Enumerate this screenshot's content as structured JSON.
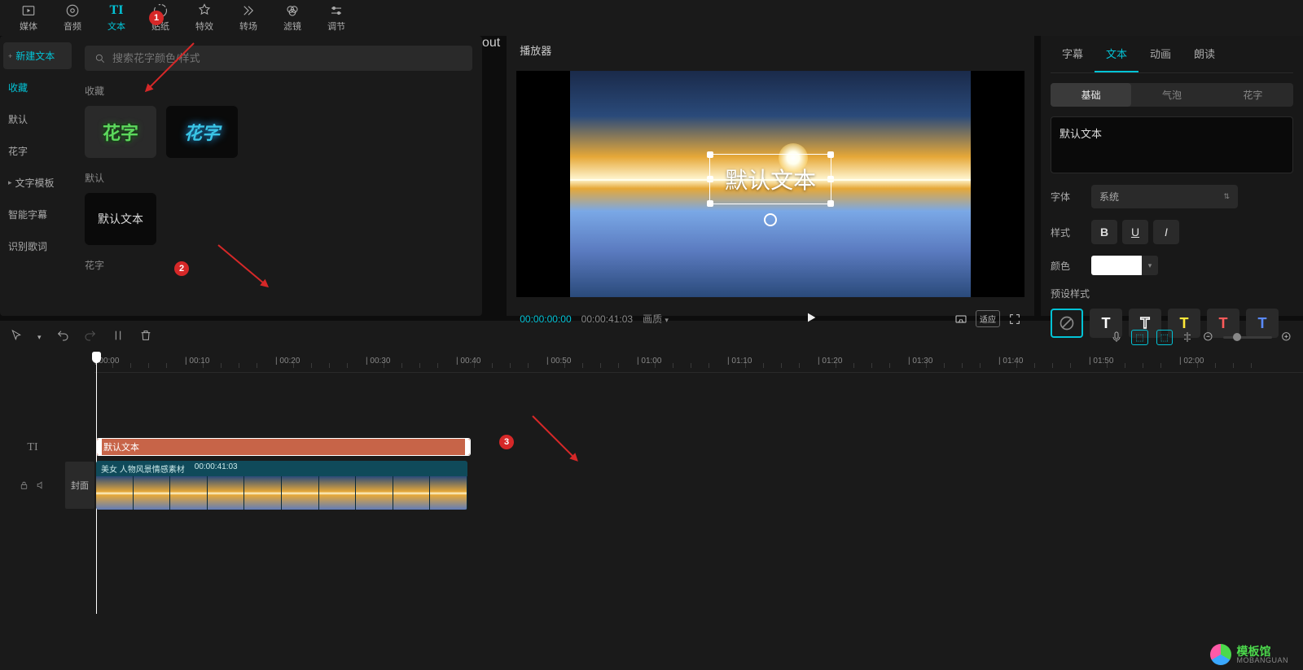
{
  "toolbar": [
    {
      "label": "媒体",
      "icon": "media"
    },
    {
      "label": "音频",
      "icon": "audio"
    },
    {
      "label": "文本",
      "icon": "text",
      "active": true
    },
    {
      "label": "贴纸",
      "icon": "sticker"
    },
    {
      "label": "特效",
      "icon": "effect"
    },
    {
      "label": "转场",
      "icon": "transition"
    },
    {
      "label": "滤镜",
      "icon": "filter"
    },
    {
      "label": "调节",
      "icon": "adjust"
    }
  ],
  "sidebar": [
    {
      "label": "新建文本",
      "active": true,
      "prefix": "+"
    },
    {
      "label": "收藏"
    },
    {
      "label": "默认"
    },
    {
      "label": "花字"
    },
    {
      "label": "文字模板",
      "expandable": true
    },
    {
      "label": "智能字幕"
    },
    {
      "label": "识别歌词"
    }
  ],
  "search": {
    "placeholder": "搜索花字颜色/样式"
  },
  "sections": {
    "favorites": "收藏",
    "default": "默认",
    "huazi": "花字"
  },
  "presets": {
    "huazi1": "花字",
    "huazi2": "花字",
    "default_text": "默认文本"
  },
  "player": {
    "title": "播放器",
    "current": "00:00:00:00",
    "total": "00:00:41:03",
    "quality": "画质",
    "ratio_btn": "适应",
    "overlay_text": "默认文本"
  },
  "right_panel": {
    "tabs": [
      {
        "label": "字幕"
      },
      {
        "label": "文本",
        "active": true
      },
      {
        "label": "动画"
      },
      {
        "label": "朗读"
      }
    ],
    "sub_tabs": [
      {
        "label": "基础",
        "active": true
      },
      {
        "label": "气泡"
      },
      {
        "label": "花字"
      }
    ],
    "text_content": "默认文本",
    "font_label": "字体",
    "font_value": "系统",
    "style_label": "样式",
    "color_label": "颜色",
    "preset_label": "预设样式"
  },
  "timeline": {
    "ticks": [
      "00:00",
      "00:10",
      "00:20",
      "00:30",
      "00:40",
      "00:50",
      "01:00",
      "01:10",
      "01:20",
      "01:30",
      "01:40",
      "01:50",
      "02:00"
    ],
    "text_clip": "默认文本",
    "video_clip_name": "美女 人物风景情感素材",
    "video_clip_duration": "00:00:41:03",
    "cover": "封面"
  },
  "annotations": {
    "b1": "1",
    "b2": "2",
    "b3": "3"
  },
  "watermark": {
    "zh": "模板馆",
    "en": "MOBANGUAN"
  }
}
